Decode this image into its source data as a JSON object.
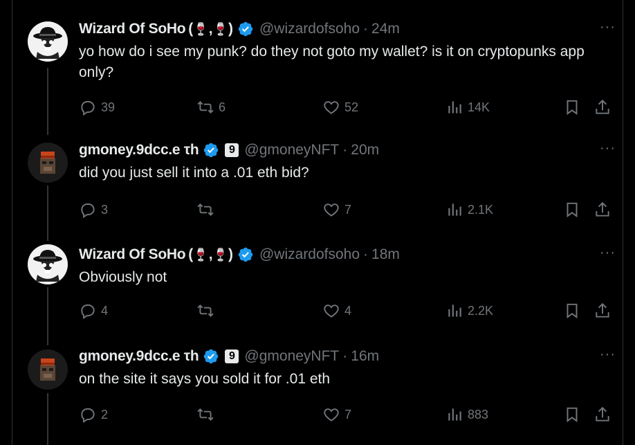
{
  "tweets": [
    {
      "name": "Wizard Of SoHo",
      "name_suffix_open": "(",
      "name_suffix_sep": ",",
      "name_suffix_close": ")",
      "emoji": "🍷",
      "handle": "@wizardofsoho",
      "separator": "·",
      "time": "24m",
      "text": "yo how do i see my punk? do they not goto my wallet? is it on cryptopunks app only?",
      "replies": "39",
      "retweets": "6",
      "likes": "52",
      "views": "14K",
      "avatar": "white-hat-skull-icon",
      "verified": true,
      "nine_badge": ""
    },
    {
      "name": "gmoney.9dcc.e τh",
      "handle": "@gmoneyNFT",
      "separator": "·",
      "time": "20m",
      "text": "did you just sell it into a .01 eth bid?",
      "replies": "3",
      "retweets": "",
      "likes": "7",
      "views": "2.1K",
      "avatar": "orange-beanie-ape-icon",
      "verified": true,
      "nine_badge": "9"
    },
    {
      "name": "Wizard Of SoHo",
      "name_suffix_open": "(",
      "name_suffix_sep": ",",
      "name_suffix_close": ")",
      "emoji": "🍷",
      "handle": "@wizardofsoho",
      "separator": "·",
      "time": "18m",
      "text": "Obviously not",
      "replies": "4",
      "retweets": "",
      "likes": "4",
      "views": "2.2K",
      "avatar": "white-hat-skull-icon",
      "verified": true,
      "nine_badge": ""
    },
    {
      "name": "gmoney.9dcc.e τh",
      "handle": "@gmoneyNFT",
      "separator": "·",
      "time": "16m",
      "text": "on the site it says you sold it for .01 eth",
      "replies": "2",
      "retweets": "",
      "likes": "7",
      "views": "883",
      "avatar": "orange-beanie-ape-icon",
      "verified": true,
      "nine_badge": "9"
    }
  ],
  "more_label": "···",
  "colors": {
    "background": "#000000",
    "text": "#e7e9ea",
    "muted": "#71767b",
    "verified": "#1d9bf0",
    "thread_line": "#333639"
  }
}
